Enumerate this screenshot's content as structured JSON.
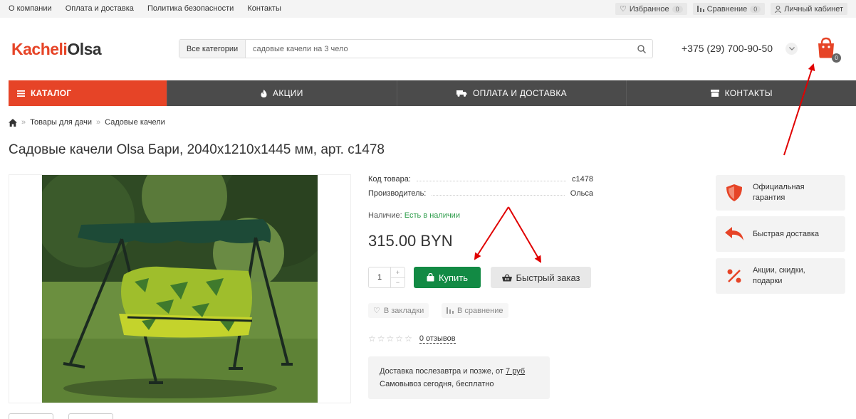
{
  "topbar": {
    "links": [
      "О компании",
      "Оплата и доставка",
      "Политика безопасности",
      "Контакты"
    ],
    "favorites_label": "Избранное",
    "favorites_count": "0",
    "compare_label": "Сравнение",
    "compare_count": "0",
    "account_label": "Личный кабинет"
  },
  "header": {
    "logo_part1": "Kacheli",
    "logo_part2": "Olsa",
    "search_category": "Все категории",
    "search_value": "садовые качели на 3 чело",
    "phone": "+375 (29) 700-90-50",
    "cart_count": "0"
  },
  "nav": {
    "catalog": "КАТАЛОГ",
    "items": [
      "АКЦИИ",
      "ОПЛАТА И ДОСТАВКА",
      "КОНТАКТЫ"
    ]
  },
  "breadcrumb": [
    "Товары для дачи",
    "Садовые качели"
  ],
  "product": {
    "title": "Садовые качели Olsa Бари, 2040x1210x1445 мм, арт. с1478",
    "code_label": "Код товара:",
    "code_value": "с1478",
    "maker_label": "Производитель:",
    "maker_value": "Ольса",
    "availability_label": "Наличие:",
    "availability_value": "Есть в наличии",
    "price": "315.00 BYN",
    "qty": "1",
    "buy_label": "Купить",
    "quick_label": "Быстрый заказ",
    "bookmark_label": "В закладки",
    "compare_label": "В сравнение",
    "reviews_label": "0 отзывов",
    "delivery_line1_prefix": "Доставка послезавтра и позже, от",
    "delivery_line1_link": "7 руб",
    "delivery_line2": "Самовывоз сегодня, бесплатно"
  },
  "features": [
    {
      "line1": "Официальная",
      "line2": "гарантия",
      "icon": "shield-icon"
    },
    {
      "line1": "Быстрая доставка",
      "line2": "",
      "icon": "return-arrow-icon"
    },
    {
      "line1": "Акции, скидки,",
      "line2": "подарки",
      "icon": "percent-icon"
    }
  ],
  "colors": {
    "accent": "#e64427",
    "buy": "#128a44",
    "nav": "#4b4b4b",
    "annotation": "#e00000"
  }
}
